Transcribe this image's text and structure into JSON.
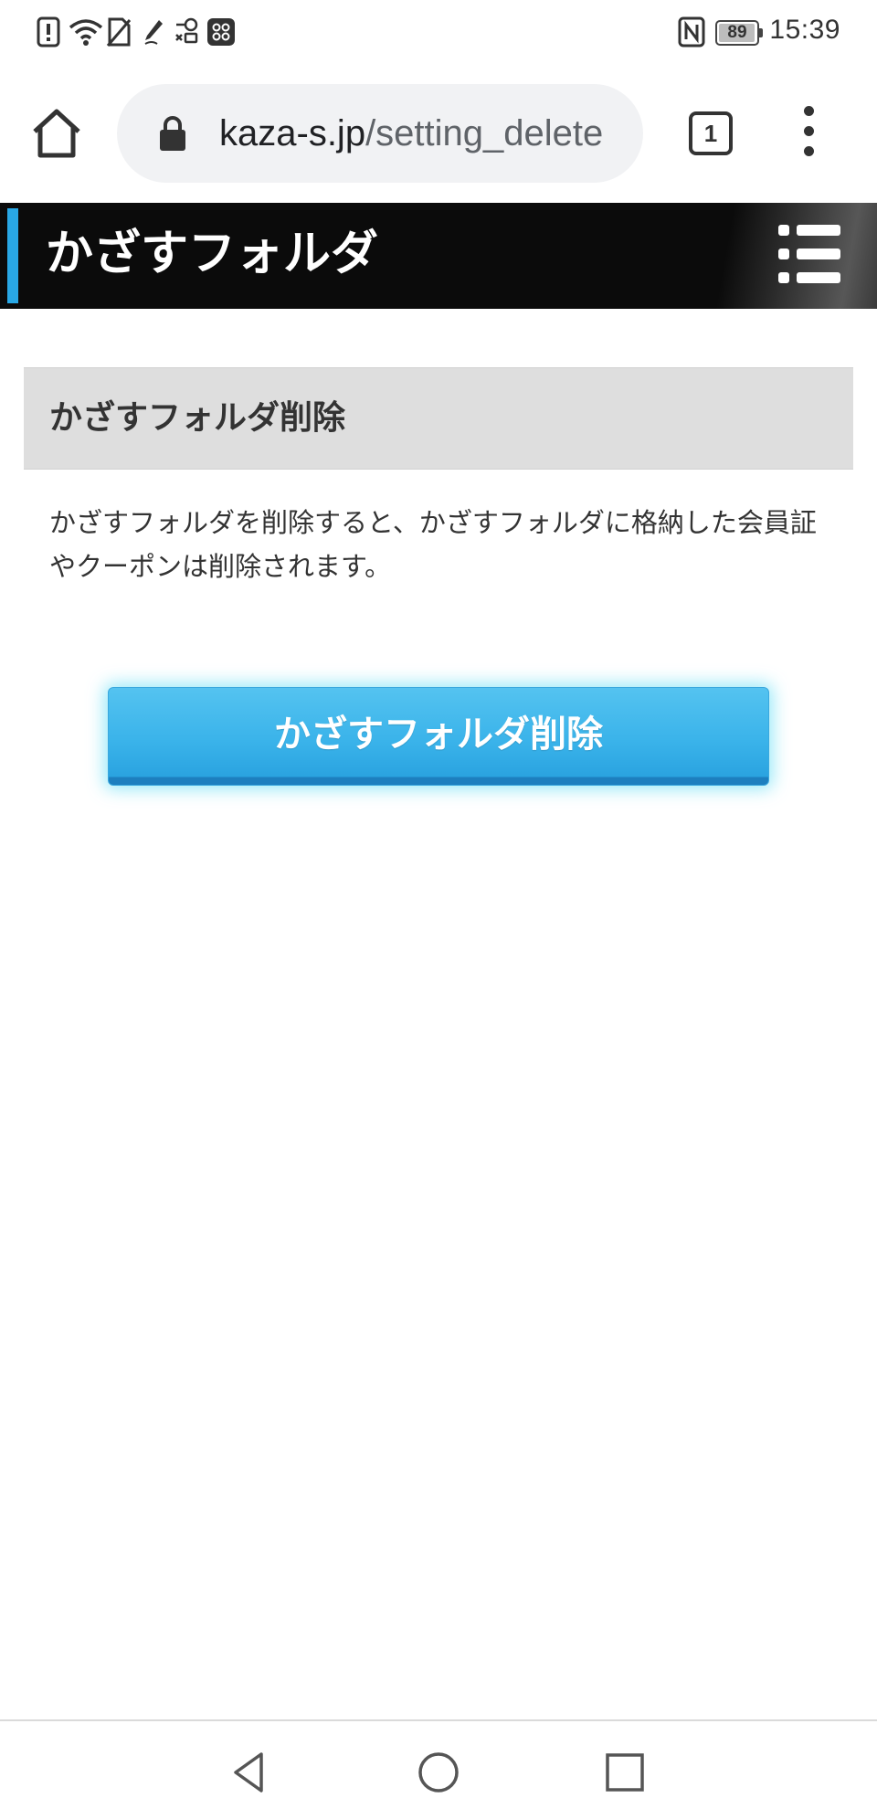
{
  "status_bar": {
    "time": "15:39",
    "battery_level": "89",
    "icons": [
      "alert-icon",
      "wifi-icon",
      "no-sim-icon",
      "pen-icon",
      "voicemail-icon",
      "app-grid-icon",
      "nfc-icon",
      "battery-icon"
    ]
  },
  "browser": {
    "url_host": "kaza-s.jp",
    "url_path": "/setting_delete",
    "tab_count": "1",
    "icons": [
      "home-icon",
      "lock-icon",
      "tab-switcher-icon",
      "overflow-menu-icon"
    ]
  },
  "header": {
    "title": "かざすフォルダ",
    "accent_color": "#29a8e6",
    "menu_icon": "hamburger-menu-icon"
  },
  "main": {
    "section_title": "かざすフォルダ削除",
    "description": "かざすフォルダを削除すると、かざすフォルダに格納した会員証やクーポンは削除されます。",
    "delete_button_label": "かざすフォルダ削除",
    "button_color": "#3ab3ea"
  },
  "nav_bar": {
    "icons": [
      "back-icon",
      "home-circle-icon",
      "recents-icon"
    ]
  }
}
